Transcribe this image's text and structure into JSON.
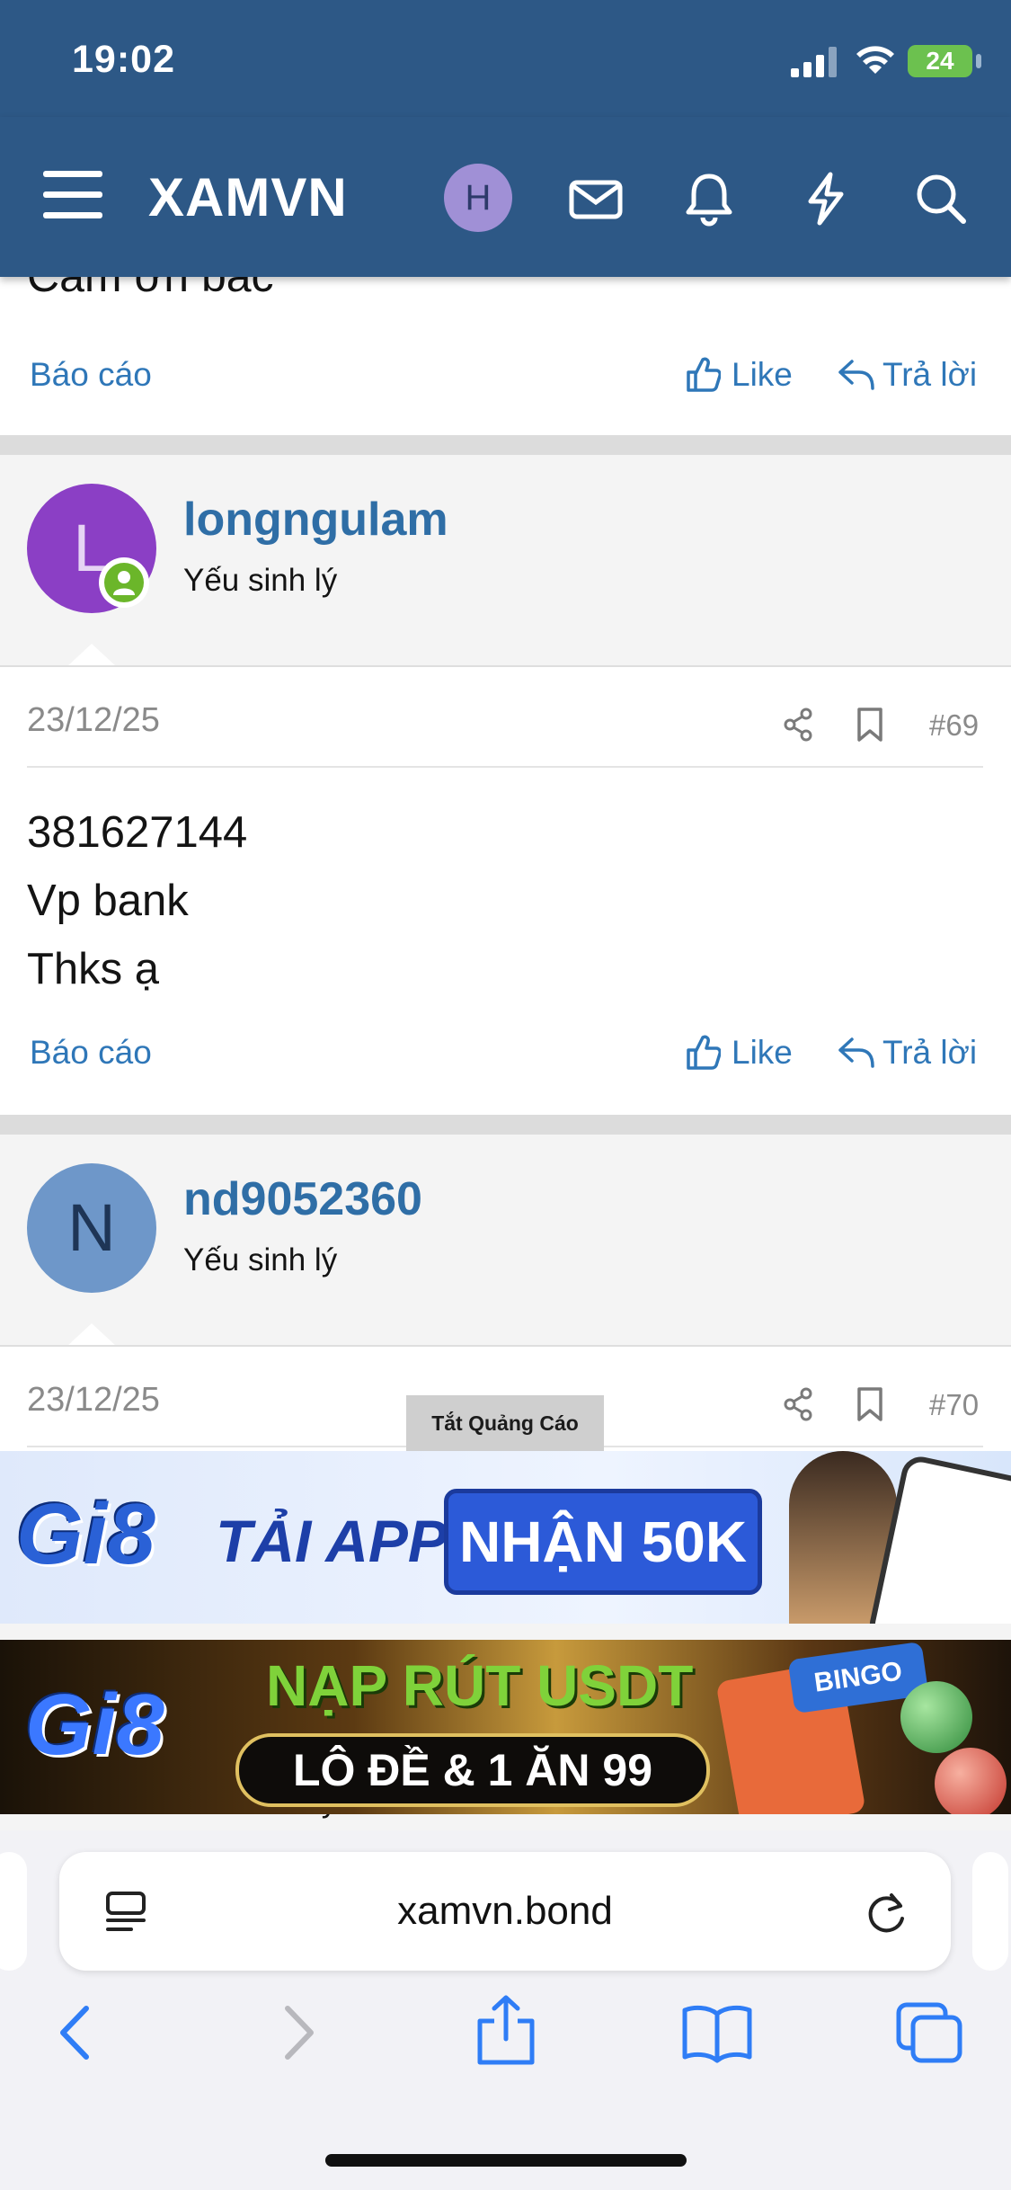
{
  "status_bar": {
    "time": "19:02",
    "battery": "24"
  },
  "header": {
    "logo": "XAMVN",
    "avatar_letter": "H"
  },
  "prev_post": {
    "partial_text": "Cảm ơn bác",
    "report_label": "Báo cáo",
    "like_label": "Like",
    "reply_label": "Trả lời"
  },
  "posts": [
    {
      "username": "longngulam",
      "user_title": "Yếu sinh lý",
      "avatar_letter": "L",
      "avatar_color": "#8b3fc5",
      "date": "23/12/25",
      "number": "#69",
      "lines": [
        "381627144",
        "Vp bank",
        "Thks ạ"
      ],
      "report_label": "Báo cáo",
      "like_label": "Like",
      "reply_label": "Trả lời"
    },
    {
      "username": "nd9052360",
      "user_title": "Yếu sinh lý",
      "avatar_letter": "N",
      "avatar_color": "#6e97c9",
      "date": "23/12/25",
      "number": "#70"
    }
  ],
  "next_user_title_partial": "Yếu sinh lý",
  "ads": {
    "close_label": "Tắt Quảng Cáo",
    "banner1": {
      "brand": "Gi8",
      "text1": "TẢI APP",
      "text2": "NHẬN 50K"
    },
    "banner2": {
      "brand": "Gi8",
      "text1": "NẠP RÚT USDT",
      "text2": "LÔ ĐỀ & 1 ĂN 99",
      "badge": "BINGO"
    }
  },
  "browser": {
    "url": "xamvn.bond"
  },
  "colors": {
    "header": "#2d5886",
    "link": "#2f77b8",
    "username": "#2f6ea6"
  }
}
